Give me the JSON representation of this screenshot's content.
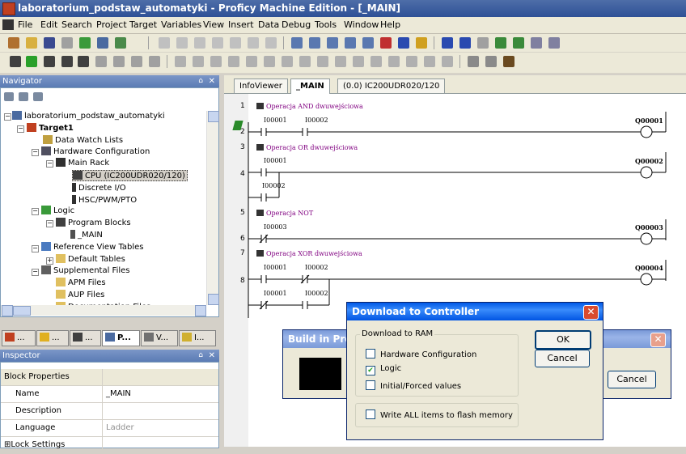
{
  "window": {
    "title": "laboratorium_podstaw_automatyki - Proficy Machine Edition - [_MAIN]"
  },
  "menu": [
    "File",
    "Edit",
    "Search",
    "Project",
    "Target",
    "Variables",
    "View",
    "Insert",
    "Data",
    "Debug",
    "Tools",
    "Window",
    "Help"
  ],
  "navigator": {
    "title": "Navigator",
    "tree": [
      {
        "label": "laboratorium_podstaw_automatyki",
        "level": 0,
        "icon": "project-icon"
      },
      {
        "label": "Target1",
        "level": 1,
        "icon": "target-icon",
        "bold": true
      },
      {
        "label": "Data Watch Lists",
        "level": 2,
        "icon": "watch-icon"
      },
      {
        "label": "Hardware Configuration",
        "level": 2,
        "icon": "hardware-icon"
      },
      {
        "label": "Main Rack",
        "level": 3,
        "icon": "rack-icon"
      },
      {
        "label": "CPU (IC200UDR020/120)",
        "level": 4,
        "icon": "cpu-icon",
        "selected": true
      },
      {
        "label": "Discrete I/O",
        "level": 4,
        "icon": "module-icon"
      },
      {
        "label": "HSC/PWM/PTO",
        "level": 4,
        "icon": "module-icon"
      },
      {
        "label": "Logic",
        "level": 2,
        "icon": "logic-icon"
      },
      {
        "label": "Program Blocks",
        "level": 3,
        "icon": "blocks-icon"
      },
      {
        "label": "_MAIN",
        "level": 4,
        "icon": "ladder-icon"
      },
      {
        "label": "Reference View Tables",
        "level": 2,
        "icon": "table-icon"
      },
      {
        "label": "Default Tables",
        "level": 3,
        "icon": "folder-icon"
      },
      {
        "label": "Supplemental Files",
        "level": 2,
        "icon": "files-icon"
      },
      {
        "label": "APM Files",
        "level": 3,
        "icon": "folder-icon"
      },
      {
        "label": "AUP Files",
        "level": 3,
        "icon": "folder-icon"
      },
      {
        "label": "Documentation Files",
        "level": 3,
        "icon": "folder-icon"
      }
    ],
    "tabs": [
      "...",
      "...",
      "...",
      "P...",
      "V...",
      "I..."
    ]
  },
  "inspector": {
    "title": "Inspector",
    "rows": [
      {
        "key": "Block Properties",
        "value": ""
      },
      {
        "key": "Name",
        "value": "_MAIN"
      },
      {
        "key": "Description",
        "value": ""
      },
      {
        "key": "Language",
        "value": "Ladder"
      },
      {
        "key": "⊞Lock Settings",
        "value": ""
      }
    ]
  },
  "editor": {
    "tabs": [
      "InfoViewer",
      "_MAIN",
      "(0.0) IC200UDR020/120"
    ],
    "line_numbers": [
      "1",
      "2",
      "3",
      "4",
      "5",
      "6",
      "7",
      "8"
    ],
    "comments": [
      "Operacja AND dwuwejściowa",
      "Operacja OR dwuwejściowa",
      "Operacja NOT",
      "Operacja XOR dwuwejściowa"
    ],
    "operands": {
      "i1": "I00001",
      "i2": "I00002",
      "i3": "I00003"
    },
    "coils": [
      "Q00001",
      "Q00002",
      "Q00003",
      "Q00004"
    ]
  },
  "download_dialog": {
    "title": "Download to Controller",
    "group": "Download to RAM",
    "options": [
      {
        "label": "Hardware Configuration",
        "checked": false
      },
      {
        "label": "Logic",
        "checked": true
      },
      {
        "label": "Initial/Forced values",
        "checked": false
      }
    ],
    "flash": {
      "label": "Write ALL items to flash memory",
      "checked": false
    },
    "ok": "OK",
    "cancel": "Cancel"
  },
  "build_dialog": {
    "title": "Build in Progress",
    "cancel": "Cancel"
  }
}
